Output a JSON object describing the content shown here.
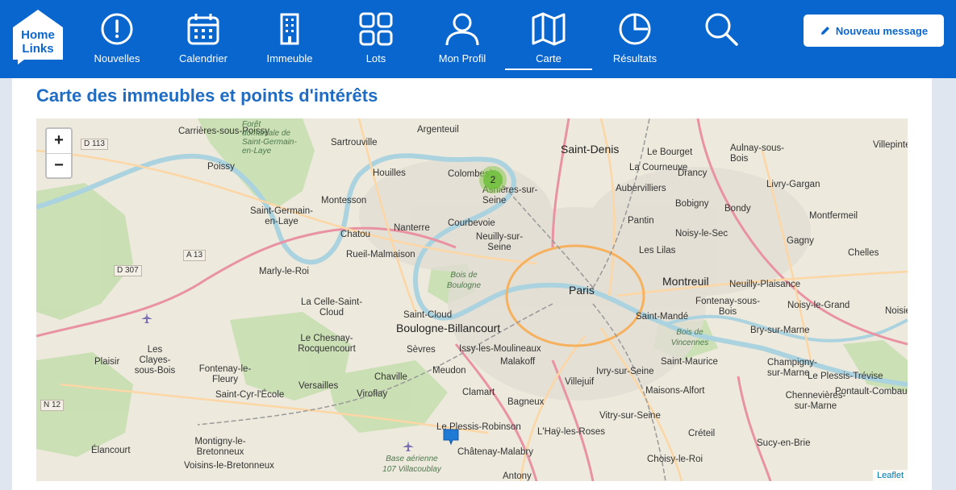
{
  "brand": {
    "line1": "Home",
    "line2": "Links"
  },
  "nav": [
    {
      "label": "Nouvelles",
      "icon": "alert-circle-icon"
    },
    {
      "label": "Calendrier",
      "icon": "calendar-icon"
    },
    {
      "label": "Immeuble",
      "icon": "building-icon"
    },
    {
      "label": "Lots",
      "icon": "grid-icon"
    },
    {
      "label": "Mon Profil",
      "icon": "user-icon"
    },
    {
      "label": "Carte",
      "icon": "map-icon",
      "active": true
    },
    {
      "label": "Résultats",
      "icon": "pie-chart-icon"
    }
  ],
  "search_icon": "search-icon",
  "new_message_label": "Nouveau message",
  "page_title": "Carte des immeubles et points d'intérêts",
  "map": {
    "zoom_in": "+",
    "zoom_out": "−",
    "cluster_count": "2",
    "attribution": "Leaflet",
    "places": {
      "paris": "Paris",
      "saint_denis": "Saint-Denis",
      "boulogne": "Boulogne-Billancourt",
      "montreuil": "Montreuil",
      "argenteuil": "Argenteuil",
      "sartrouville": "Sartrouville",
      "houilles": "Houilles",
      "colombes": "Colombes",
      "asnieres": "Asnières-sur-Seine",
      "la_courneuve": "La Courneuve",
      "aubervilliers": "Aubervilliers",
      "le_bourget": "Le Bourget",
      "drancy": "Drancy",
      "bobigny": "Bobigny",
      "bondy": "Bondy",
      "aulnay": "Aulnay-sous-Bois",
      "livry": "Livry-Gargan",
      "villepinte": "Villepinte",
      "montfermeil": "Montfermeil",
      "gagny": "Gagny",
      "chelles": "Chelles",
      "noisy_le_sec": "Noisy-le-Sec",
      "les_lilas": "Les Lilas",
      "pantin": "Pantin",
      "neuilly_plaisance": "Neuilly-Plaisance",
      "fontenay_bois": "Fontenay-sous-Bois",
      "noisy_le_grand": "Noisy-le-Grand",
      "bry": "Bry-sur-Marne",
      "champigny": "Champigny-sur-Marne",
      "le_plessis_trevise": "Le Plessis-Trévise",
      "pontault": "Pontault-Combault",
      "chennevieres": "Chennevières-sur-Marne",
      "sucy": "Sucy-en-Brie",
      "creteil": "Créteil",
      "maisons_alfort": "Maisons-Alfort",
      "saint_maurice": "Saint-Maurice",
      "saint_mande": "Saint-Mandé",
      "ivry": "Ivry-sur-Seine",
      "vitry": "Vitry-sur-Seine",
      "choisy": "Choisy-le-Roi",
      "lhay": "L'Haÿ-les-Roses",
      "chatenay": "Châtenay-Malabry",
      "antony": "Antony",
      "bagneux": "Bagneux",
      "clamart": "Clamart",
      "malakoff": "Malakoff",
      "villejuif": "Villejuif",
      "issy": "Issy-les-Moulineaux",
      "meudon": "Meudon",
      "sevres": "Sèvres",
      "saint_cloud": "Saint-Cloud",
      "chaville": "Chaville",
      "viroflay": "Viroflay",
      "versailles": "Versailles",
      "le_plessis_robinson": "Le Plessis-Robinson",
      "courbevoie": "Courbevoie",
      "neuilly_seine": "Neuilly-sur-Seine",
      "nanterre": "Nanterre",
      "rueil": "Rueil-Malmaison",
      "chatou": "Chatou",
      "montesson": "Montesson",
      "saint_germain": "Saint-Germain-en-Laye",
      "poissy": "Poissy",
      "carrieres": "Carrières-sous-Poissy",
      "marly": "Marly-le-Roi",
      "la_celle": "La Celle-Saint-Cloud",
      "le_chesnay": "Le Chesnay-Rocquencourt",
      "les_clayes": "Les Clayes-sous-Bois",
      "plaisir": "Plaisir",
      "fontenay_fleury": "Fontenay-le-Fleury",
      "saint_cyr": "Saint-Cyr-l'École",
      "montigny": "Montigny-le-Bretonneux",
      "voisins": "Voisins-le-Bretonneux",
      "elancourt": "Élancourt",
      "foret_st_germain": "Forêt domaniale de Saint-Germain-en-Laye",
      "bois_boulogne": "Bois de Boulogne",
      "bois_vincennes": "Bois de Vincennes",
      "base_aerienne": "Base aérienne 107 Villacoublay"
    },
    "roads": {
      "d113": "D 113",
      "a13": "A 13",
      "d307": "D 307",
      "n12": "N 12"
    }
  },
  "colors": {
    "brand_blue": "#0a66cf",
    "title_blue": "#1f6cc4",
    "cluster_green": "#6ebe3c",
    "marker_blue": "#1f7ad6"
  }
}
